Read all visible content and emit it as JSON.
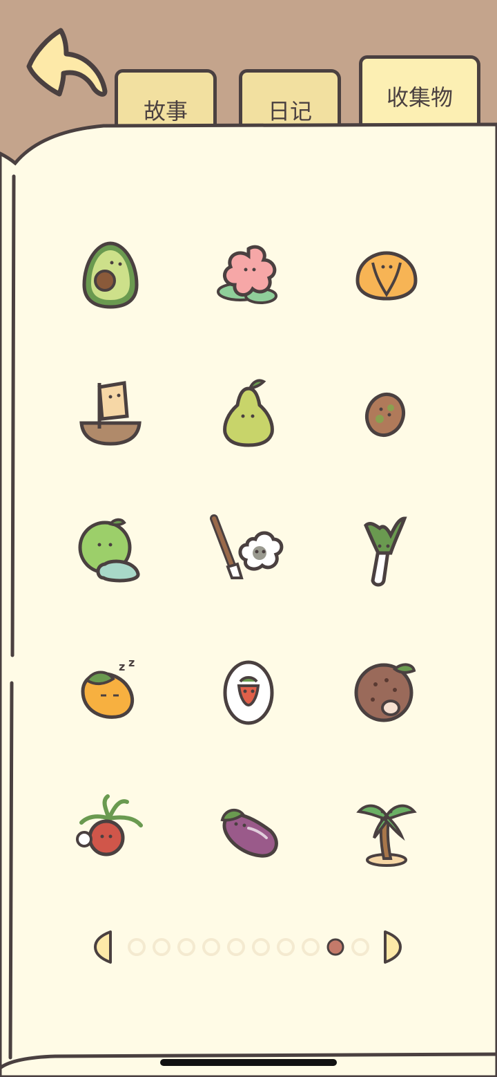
{
  "tabs": [
    {
      "label": "故事",
      "active": false
    },
    {
      "label": "日记",
      "active": false
    },
    {
      "label": "收集物",
      "active": true
    }
  ],
  "colors": {
    "background": "#c4a48c",
    "paper": "#fffbe6",
    "outline": "#4a4040",
    "tab": "#f2e0a0",
    "dot_active": "#c47a6a",
    "dot_inactive": "#f4ead0"
  },
  "items": [
    {
      "icon": "avocado-icon"
    },
    {
      "icon": "flower-icon"
    },
    {
      "icon": "cabbage-icon"
    },
    {
      "icon": "sailboat-icon"
    },
    {
      "icon": "pear-icon"
    },
    {
      "icon": "kiwi-icon"
    },
    {
      "icon": "green-apple-icon"
    },
    {
      "icon": "paintbrush-cloud-icon"
    },
    {
      "icon": "leek-icon"
    },
    {
      "icon": "sleeping-mango-icon"
    },
    {
      "icon": "strawberry-egg-icon"
    },
    {
      "icon": "durian-icon"
    },
    {
      "icon": "lychee-icon"
    },
    {
      "icon": "eggplant-icon"
    },
    {
      "icon": "palm-tree-icon"
    }
  ],
  "pagination": {
    "total": 10,
    "current": 9
  }
}
